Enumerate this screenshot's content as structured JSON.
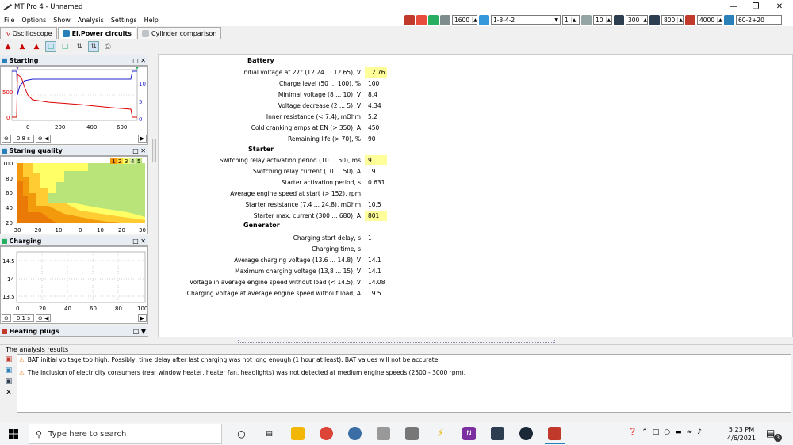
{
  "app": {
    "title": "MT Pro 4 - Unnamed",
    "menu": [
      "File",
      "Options",
      "Show",
      "Analysis",
      "Settings",
      "Help"
    ]
  },
  "toolbar": {
    "rpm1": "1600",
    "firing_order": "1-3-4-2",
    "cyl": "1",
    "v1": "10",
    "v2": "300",
    "v3": "800",
    "v4": "4000",
    "v5": "60-2+20"
  },
  "tabs": [
    "Oscilloscope",
    "El.Power circuits",
    "Cylinder comparison"
  ],
  "starting": {
    "title": "Starting",
    "y_left": [
      "500",
      "0"
    ],
    "y_right": [
      "10",
      "5",
      "0"
    ],
    "x": [
      "0",
      "200",
      "400",
      "600"
    ],
    "time": "0.8 s"
  },
  "quality": {
    "title": "Staring quality",
    "legend": [
      "1",
      "2",
      "3",
      "4",
      "5"
    ],
    "y": [
      "100",
      "80",
      "60",
      "40",
      "20"
    ],
    "x": [
      "-30",
      "-20",
      "-10",
      "0",
      "10",
      "20",
      "30"
    ]
  },
  "charging": {
    "title": "Charging",
    "y": [
      "14.5",
      "14",
      "13.5"
    ],
    "x": [
      "0",
      "20",
      "40",
      "60",
      "80",
      "100"
    ],
    "time": "0.1 s"
  },
  "heating": {
    "title": "Heating plugs"
  },
  "results": {
    "battery": "Battery",
    "starter": "Starter",
    "generator": "Generator",
    "battery_rows": [
      {
        "label": "Initial voltage at 27° (12.24 ... 12.65), V",
        "value": "12.76",
        "warn": true
      },
      {
        "label": "Charge level (50 ... 100), %",
        "value": "100",
        "warn": false
      },
      {
        "label": "Minimal voltage (8 ... 10), V",
        "value": "8.4",
        "warn": false
      },
      {
        "label": "Voltage decrease (2 ... 5), V",
        "value": "4.34",
        "warn": false
      },
      {
        "label": "Inner resistance (< 7.4), mOhm",
        "value": "5.2",
        "warn": false
      },
      {
        "label": "Cold cranking amps at EN (> 350), A",
        "value": "450",
        "warn": false
      },
      {
        "label": "Remaining life (> 70), %",
        "value": "90",
        "warn": false
      }
    ],
    "starter_rows": [
      {
        "label": "Switching relay activation period (10 ... 50), ms",
        "value": "9",
        "warn": true
      },
      {
        "label": "Switching relay current (10 ... 50), A",
        "value": "19",
        "warn": false
      },
      {
        "label": "Starter activation period, s",
        "value": "0.631",
        "warn": false
      },
      {
        "label": "Average engine speed at start (> 152), rpm",
        "value": "",
        "warn": false
      },
      {
        "label": "Starter resistance (7.4 ... 24.8), mOhm",
        "value": "10.5",
        "warn": false
      },
      {
        "label": "Starter max. current (300 ... 680), A",
        "value": "801",
        "warn": true
      }
    ],
    "generator_rows": [
      {
        "label": "Charging start delay, s",
        "value": "1",
        "warn": false
      },
      {
        "label": "Charging time, s",
        "value": "",
        "warn": false
      },
      {
        "label": "Average charging voltage (13.6 ... 14.8), V",
        "value": "14.1",
        "warn": false
      },
      {
        "label": "Maximum charging voltage (13,8 ... 15), V",
        "value": "14.1",
        "warn": false
      },
      {
        "label": "Voltage in average engine speed without load (< 14.5), V",
        "value": "14.08",
        "warn": false
      },
      {
        "label": "Charging voltage at average engine speed without load, A",
        "value": "19.5",
        "warn": false
      }
    ]
  },
  "analysis": {
    "title": "The analysis results",
    "messages": [
      "BAT initial voltage too high. Possibly, time delay after last charging was not long enough (1 hour at least). BAT values will not be accurate.",
      "The inclusion of electricity consumers (rear window heater, heater fan, headlights) was not detected at medium engine speeds (2500 - 3000 rpm)."
    ]
  },
  "taskbar": {
    "search_placeholder": "Type here to search",
    "time": "5:23 PM",
    "date": "4/6/2021",
    "notif": "3"
  }
}
